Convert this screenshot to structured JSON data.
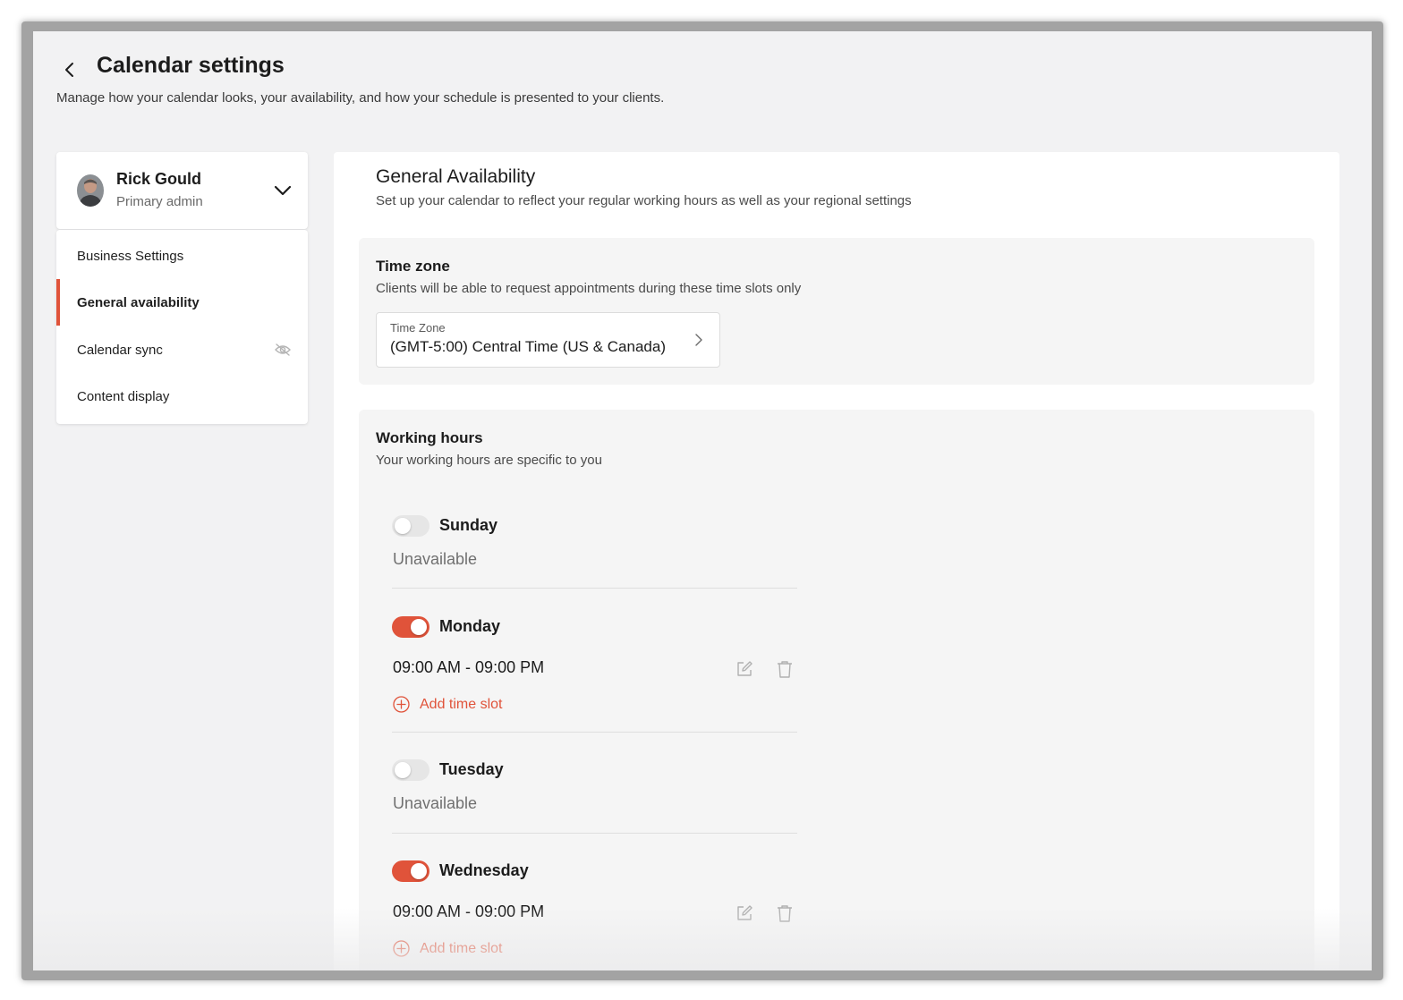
{
  "header": {
    "title": "Calendar settings",
    "subtitle": "Manage how your calendar looks, your availability, and how your schedule is presented to your clients."
  },
  "user": {
    "name": "Rick Gould",
    "role": "Primary admin"
  },
  "nav": {
    "items": [
      {
        "label": "Business Settings",
        "active": false
      },
      {
        "label": "General availability",
        "active": true
      },
      {
        "label": "Calendar sync",
        "active": false,
        "icon": "eye-slash-icon"
      },
      {
        "label": "Content display",
        "active": false
      }
    ]
  },
  "availability": {
    "title": "General Availability",
    "subtitle": "Set up your calendar to reflect your regular working hours as well as your regional settings"
  },
  "timezone": {
    "title": "Time zone",
    "subtitle": "Clients will be able to request appointments during these time slots only",
    "field_label": "Time Zone",
    "value": "(GMT-5:00) Central Time (US & Canada)"
  },
  "working_hours": {
    "title": "Working hours",
    "subtitle": "Your working hours are specific to you",
    "add_slot_label": "Add time slot",
    "days": [
      {
        "name": "Sunday",
        "enabled": false,
        "status": "Unavailable"
      },
      {
        "name": "Monday",
        "enabled": true,
        "slot": "09:00 AM - 09:00 PM"
      },
      {
        "name": "Tuesday",
        "enabled": false,
        "status": "Unavailable"
      },
      {
        "name": "Wednesday",
        "enabled": true,
        "slot": "09:00 AM - 09:00 PM"
      }
    ]
  },
  "colors": {
    "accent": "#e0533a",
    "background": "#f2f2f3",
    "section": "#f5f5f5"
  }
}
